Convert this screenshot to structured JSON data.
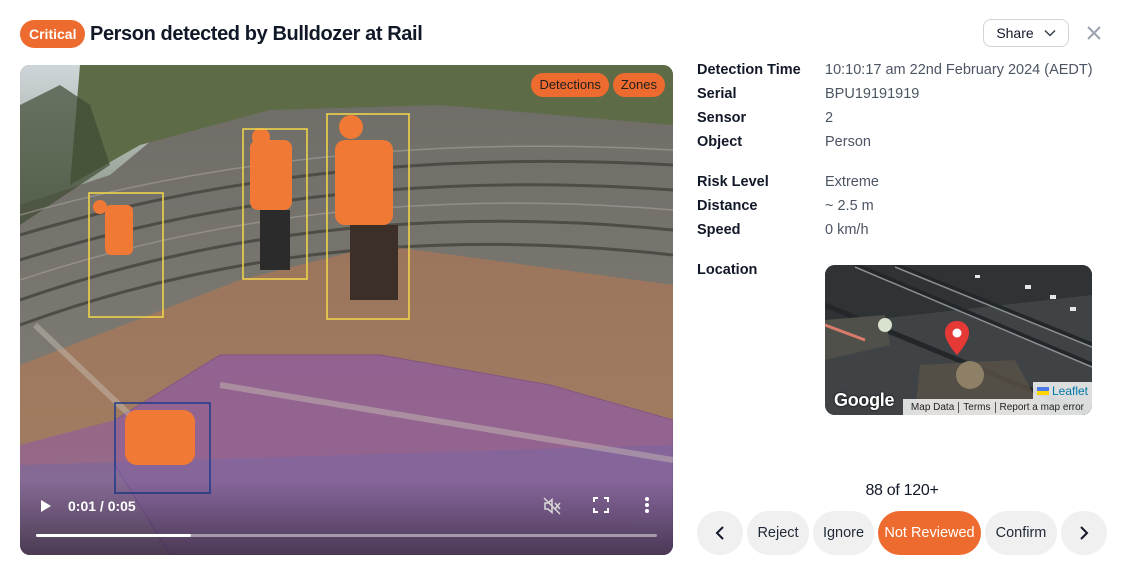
{
  "header": {
    "badge": "Critical",
    "title": "Person detected by Bulldozer at Rail",
    "share_label": "Share"
  },
  "video": {
    "toggles": [
      "Detections",
      "Zones"
    ],
    "current_time": "0:01",
    "duration": "0:05",
    "time_display": "0:01 / 0:05",
    "progress": 0.25,
    "detection_count": 4
  },
  "details": {
    "rows": [
      {
        "label": "Detection Time",
        "value": "10:10:17 am 22nd February 2024 (AEDT)"
      },
      {
        "label": "Serial",
        "value": "BPU19191919"
      },
      {
        "label": "Sensor",
        "value": "2"
      },
      {
        "label": "Object",
        "value": "Person"
      },
      {
        "label": "Risk Level",
        "value": "Extreme"
      },
      {
        "label": "Distance",
        "value": "~ 2.5 m"
      },
      {
        "label": "Speed",
        "value": "0 km/h"
      }
    ],
    "location_label": "Location"
  },
  "map": {
    "google": "Google",
    "leaflet": "Leaflet",
    "attribution": [
      "Map Data",
      "Terms",
      "Report a map error"
    ]
  },
  "review": {
    "counter": "88 of 120+",
    "buttons": {
      "reject": "Reject",
      "ignore": "Ignore",
      "not_reviewed": "Not Reviewed",
      "confirm": "Confirm"
    }
  },
  "colors": {
    "accent": "#ee6b2f",
    "zone_orange": "#e07a3c",
    "zone_purple": "#8a52b8",
    "box_yellow": "#f5d94a",
    "box_blue": "#1e3a8a"
  },
  "icons": {
    "share": "chevron-down-icon",
    "close": "close-icon",
    "prev": "chevron-left-icon",
    "next": "chevron-right-icon",
    "play": "play-icon",
    "mute": "muted-speaker-icon",
    "fullscreen": "fullscreen-icon",
    "more": "more-vertical-icon",
    "pin": "map-pin-icon"
  }
}
